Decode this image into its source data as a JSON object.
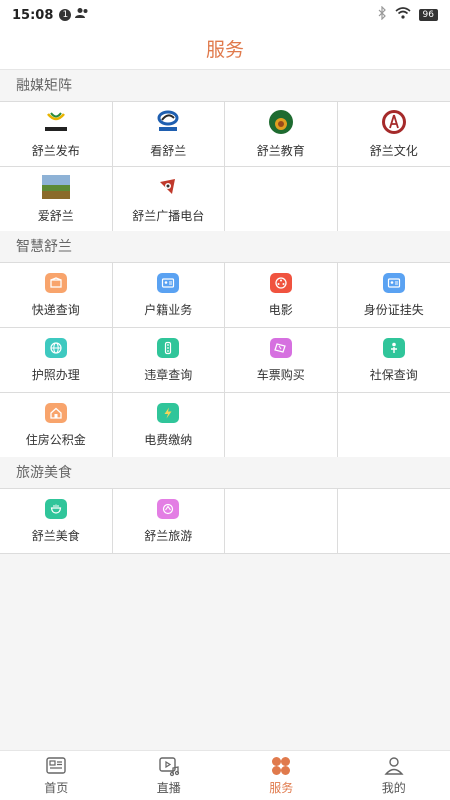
{
  "status_bar": {
    "time": "15:08",
    "notif_count": "1",
    "battery": "96"
  },
  "header": {
    "title": "服务"
  },
  "sections": [
    {
      "title": "融媒矩阵",
      "items": [
        {
          "label": "舒兰发布",
          "logo_text": "舒兰发布"
        },
        {
          "label": "看舒兰",
          "logo_text": "看舒兰"
        },
        {
          "label": "舒兰教育"
        },
        {
          "label": "舒兰文化"
        },
        {
          "label": "爱舒兰"
        },
        {
          "label": "舒兰广播电台"
        }
      ]
    },
    {
      "title": "智慧舒兰",
      "items": [
        {
          "label": "快递查询",
          "icon": "package-icon",
          "color": "#f8a46c"
        },
        {
          "label": "户籍业务",
          "icon": "id-card-icon",
          "color": "#5aa2f2"
        },
        {
          "label": "电影",
          "icon": "film-reel-icon",
          "color": "#f0533f"
        },
        {
          "label": "身份证挂失",
          "icon": "id-card-icon",
          "color": "#5aa2f2"
        },
        {
          "label": "护照办理",
          "icon": "globe-icon",
          "color": "#3ec9c0"
        },
        {
          "label": "违章查询",
          "icon": "traffic-light-icon",
          "color": "#30c59a"
        },
        {
          "label": "车票购买",
          "icon": "ticket-icon",
          "color": "#d670e0"
        },
        {
          "label": "社保查询",
          "icon": "person-icon",
          "color": "#30c59a"
        },
        {
          "label": "住房公积金",
          "icon": "home-icon",
          "color": "#f8a46c"
        },
        {
          "label": "电费缴纳",
          "icon": "electric-icon",
          "color": "#30c59a"
        }
      ]
    },
    {
      "title": "旅游美食",
      "items": [
        {
          "label": "舒兰美食",
          "icon": "food-icon",
          "color": "#30c59a"
        },
        {
          "label": "舒兰旅游",
          "icon": "travel-icon",
          "color": "#e37ee4"
        }
      ]
    }
  ],
  "tabbar": [
    {
      "label": "首页",
      "icon": "news-icon"
    },
    {
      "label": "直播",
      "icon": "live-video-icon"
    },
    {
      "label": "服务",
      "icon": "services-icon",
      "active": true
    },
    {
      "label": "我的",
      "icon": "user-icon"
    }
  ],
  "colors": {
    "accent": "#e07a4c"
  }
}
